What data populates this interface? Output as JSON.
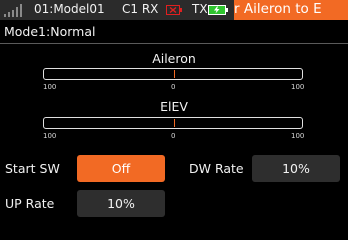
{
  "status_bar": {
    "model": "01:Model01",
    "receiver": "C1 RX",
    "transmitter": "TX",
    "scrolling_title": "r  Aileron to E",
    "icons": [
      "signal-strength-icon",
      "rx-battery-empty-icon",
      "tx-battery-charging-icon"
    ],
    "colors": {
      "accent": "#f26a24",
      "rx_battery": "#e02020",
      "tx_battery": "#2ec42e"
    }
  },
  "mode": "Mode1:Normal",
  "bars": [
    {
      "title": "Aileron",
      "scale_left": "100",
      "scale_center": "0",
      "scale_right": "100",
      "value": 0
    },
    {
      "title": "ElEV",
      "scale_left": "100",
      "scale_center": "0",
      "scale_right": "100",
      "value": 0
    }
  ],
  "controls": {
    "start_sw": {
      "label": "Start SW",
      "value": "Off"
    },
    "dw_rate": {
      "label": "DW Rate",
      "value": "10%"
    },
    "up_rate": {
      "label": "UP Rate",
      "value": "10%"
    }
  }
}
